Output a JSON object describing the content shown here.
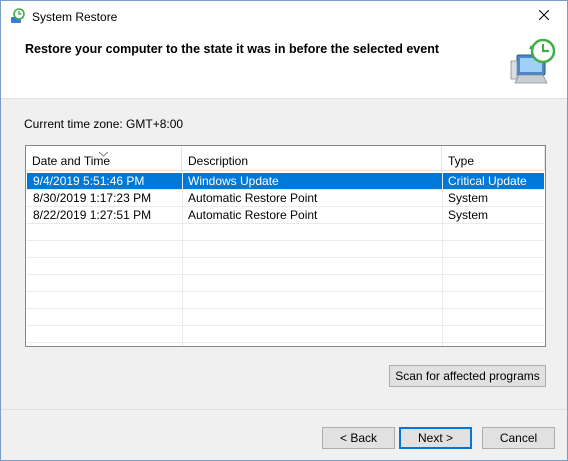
{
  "window": {
    "title": "System Restore",
    "heading": "Restore your computer to the state it was in before the selected event",
    "timezone_label": "Current time zone: GMT+8:00",
    "icons": {
      "app": "system-restore-icon",
      "header": "restore-computer-icon",
      "close": "close-icon"
    }
  },
  "list": {
    "columns": [
      "Date and Time",
      "Description",
      "Type"
    ],
    "sorted_column": "Date and Time",
    "rows": [
      {
        "date": "9/4/2019 5:51:46 PM",
        "description": "Windows Update",
        "type": "Critical Update",
        "selected": true
      },
      {
        "date": "8/30/2019 1:17:23 PM",
        "description": "Automatic Restore Point",
        "type": "System",
        "selected": false
      },
      {
        "date": "8/22/2019 1:27:51 PM",
        "description": "Automatic Restore Point",
        "type": "System",
        "selected": false
      }
    ]
  },
  "buttons": {
    "scan": "Scan for affected programs",
    "back": "< Back",
    "next": "Next >",
    "cancel": "Cancel"
  },
  "colors": {
    "accent": "#0078d7",
    "window_border": "#7a9cc6"
  }
}
